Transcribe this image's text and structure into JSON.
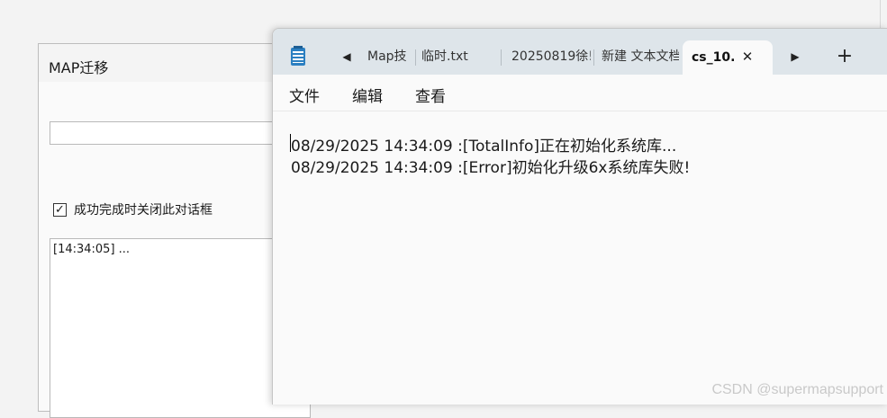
{
  "dialog": {
    "title": "MAP迁移",
    "checkbox_label": "成功完成时关闭此对话框",
    "checkbox_mark": "✓",
    "log_line": "[14:34:05] ..."
  },
  "notepad": {
    "nav_prev": "◀",
    "nav_next": "▶",
    "tabs": [
      {
        "label": "Map技"
      },
      {
        "label": "临时.txt"
      },
      {
        "label": "20250819徐!"
      },
      {
        "label": "新建 文本文档"
      }
    ],
    "active_tab": {
      "label": "cs_10.",
      "close": "✕"
    },
    "add_tab": "+",
    "menu": {
      "file": "文件",
      "edit": "编辑",
      "view": "查看"
    },
    "lines": [
      "08/29/2025 14:34:09 :[TotalInfo]正在初始化系统库...",
      "08/29/2025 14:34:09 :[Error]初始化升级6x系统库失败!"
    ]
  },
  "watermark": "CSDN @supermapsupport",
  "icons": {
    "app": "notepad-icon",
    "close": "close-icon",
    "add": "plus-icon"
  }
}
